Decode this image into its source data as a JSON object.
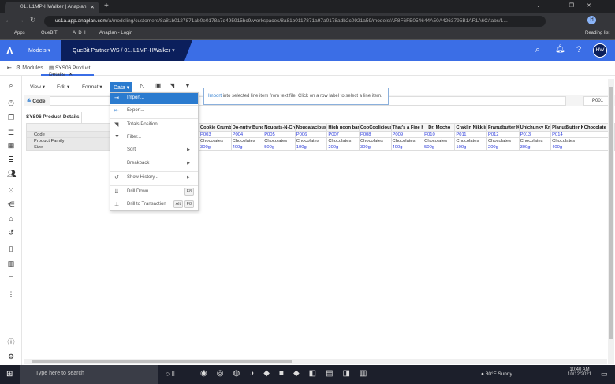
{
  "browser": {
    "tab_title": "01. L1MP-HWalker | Anaplan",
    "url_host": "us1a.app.anaplan.com",
    "url_path": "/a/modeling/customers/8a81b0127871ab0e0178a7d495915bc9/workspaces/8a81b0117871a97a0178adb2c0921a59/models/AF8F6FE054644A50A4263795B1AF1A6C/tabs/1...",
    "bookmarks": [
      "Apps",
      "QueBIT",
      "A_D_I",
      "Anaplan - Login"
    ],
    "reading_list": "Reading list",
    "profile": "H"
  },
  "header": {
    "models": "Models",
    "workspace": "QueBit Partner WS / 01. L1MP-HWalker",
    "avatar": "HW",
    "brand_color": "#3b6ee6"
  },
  "tabs": [
    {
      "label": "Modules"
    },
    {
      "label": "SYS06 Product Details"
    }
  ],
  "toolbar": {
    "view": "View",
    "edit": "Edit",
    "format": "Format",
    "data": "Data"
  },
  "code_filter": {
    "label": "Code",
    "value": "P001"
  },
  "module_title": "SYS06 Product Details",
  "data_menu": [
    {
      "label": "Import...",
      "icon": "import-icon",
      "active": true
    },
    {
      "label": "Export...",
      "icon": "export-icon"
    },
    {
      "label": "Totals Position...",
      "icon": "totals-icon"
    },
    {
      "label": "Filter...",
      "icon": "filter-icon"
    },
    {
      "label": "Sort",
      "submenu": true
    },
    {
      "label": "Breakback",
      "submenu": true
    },
    {
      "label": "Show History...",
      "icon": "history-icon",
      "submenu": true
    },
    {
      "label": "Drill Down",
      "icon": "drill-down-icon",
      "shortcut": [
        "F8"
      ]
    },
    {
      "label": "Drill to Transaction",
      "icon": "drill-transaction-icon",
      "shortcut": [
        "Alt",
        "F8"
      ]
    }
  ],
  "tooltip": {
    "link": "Import",
    "text": " into selected line item from text file. Click on a row label to select a line item."
  },
  "grid": {
    "row_labels": [
      "Code",
      "Product Family",
      "Size"
    ],
    "columns": [
      {
        "name": "Cookie Crumb",
        "code": "P003",
        "family": "Chocolates",
        "size": "300g"
      },
      {
        "name": "Do-nutty Bunc",
        "code": "P004",
        "family": "Chocolates",
        "size": "400g"
      },
      {
        "name": "Nougats-N-Cre",
        "code": "P005",
        "family": "Chocolates",
        "size": "500g"
      },
      {
        "name": "Nougatacious",
        "code": "P006",
        "family": "Chocolates",
        "size": "100g"
      },
      {
        "name": "High noon bar",
        "code": "P007",
        "family": "Chocolates",
        "size": "200g"
      },
      {
        "name": "CooCoolicious",
        "code": "P008",
        "family": "Chocolates",
        "size": "300g"
      },
      {
        "name": "That's a Fine H",
        "code": "P009",
        "family": "Chocolates",
        "size": "400g"
      },
      {
        "name": "Dr. Mocho",
        "code": "P010",
        "family": "Chocolates",
        "size": "500g"
      },
      {
        "name": "Craklin Nikklin",
        "code": "P011",
        "family": "Chocolates",
        "size": "100g"
      },
      {
        "name": "Franutbutter K",
        "code": "P012",
        "family": "Chocolates",
        "size": "200g"
      },
      {
        "name": "Unichunky Kri",
        "code": "P013",
        "family": "Chocolates",
        "size": "300g"
      },
      {
        "name": "PlanutButter K",
        "code": "P014",
        "family": "Chocolates",
        "size": "400g"
      },
      {
        "name": "Chocolate",
        "code": "",
        "family": "",
        "size": ""
      }
    ]
  },
  "taskbar": {
    "search_placeholder": "Type here to search",
    "weather": "80°F  Sunny",
    "time": "10:40 AM",
    "date": "10/12/2021"
  }
}
